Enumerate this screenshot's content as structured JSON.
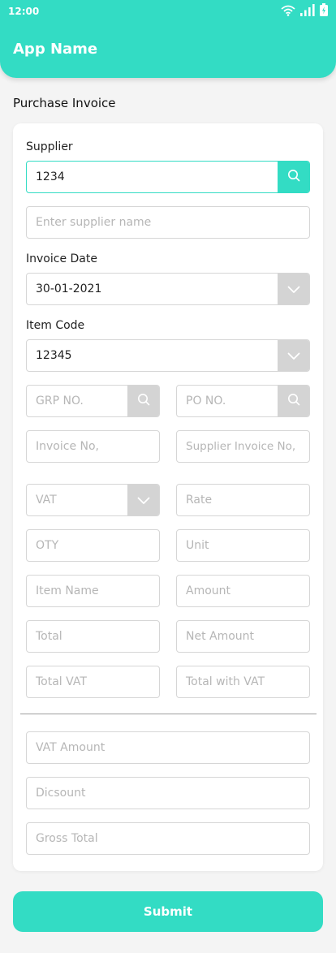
{
  "status_bar": {
    "time": "12:00"
  },
  "header": {
    "title": "App Name"
  },
  "page": {
    "title": "Purchase Invoice"
  },
  "form": {
    "supplier": {
      "label": "Supplier",
      "value": "1234"
    },
    "supplier_name": {
      "placeholder": "Enter supplier name"
    },
    "invoice_date": {
      "label": "Invoice Date",
      "value": "30-01-2021"
    },
    "item_code": {
      "label": "Item Code",
      "value": "12345"
    },
    "grp_no": {
      "placeholder": "GRP NO."
    },
    "po_no": {
      "placeholder": "PO NO."
    },
    "invoice_no": {
      "placeholder": "Invoice No,"
    },
    "supplier_invoice_no": {
      "placeholder": "Supplier Invoice No,"
    },
    "vat": {
      "placeholder": "VAT"
    },
    "rate": {
      "placeholder": "Rate"
    },
    "qty": {
      "placeholder": "OTY"
    },
    "unit": {
      "placeholder": "Unit"
    },
    "item_name": {
      "placeholder": "Item Name"
    },
    "amount": {
      "placeholder": "Amount"
    },
    "total": {
      "placeholder": "Total"
    },
    "net_amount": {
      "placeholder": "Net Amount"
    },
    "total_vat": {
      "placeholder": "Total VAT"
    },
    "total_with_vat": {
      "placeholder": "Total with VAT"
    },
    "vat_amount": {
      "placeholder": "VAT Amount"
    },
    "discount": {
      "placeholder": "Dicsount"
    },
    "gross_total": {
      "placeholder": "Gross Total"
    }
  },
  "actions": {
    "submit_label": "Submit"
  },
  "icons": {
    "search": "search-icon",
    "dropdown": "chevron-down-icon",
    "wifi": "wifi-icon",
    "signal": "signal-icon",
    "battery": "battery-icon"
  },
  "colors": {
    "accent": "#33dcc4",
    "addon_grey": "#d4d4d4",
    "placeholder": "#b6b6b6"
  }
}
